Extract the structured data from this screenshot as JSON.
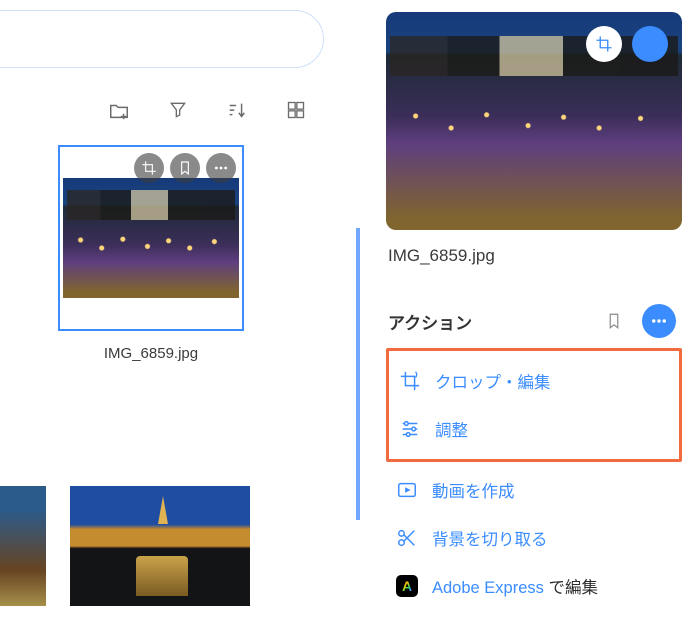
{
  "left": {
    "thumbnail_caption": "IMG_6859.jpg"
  },
  "right": {
    "filename": "IMG_6859.jpg",
    "section_title": "アクション",
    "actions": {
      "crop_edit": "クロップ・編集",
      "adjust": "調整",
      "create_video": "動画を作成",
      "remove_bg": "背景を切り取る",
      "adobe_brand": "Adobe Express",
      "adobe_suffix": " で編集"
    }
  }
}
